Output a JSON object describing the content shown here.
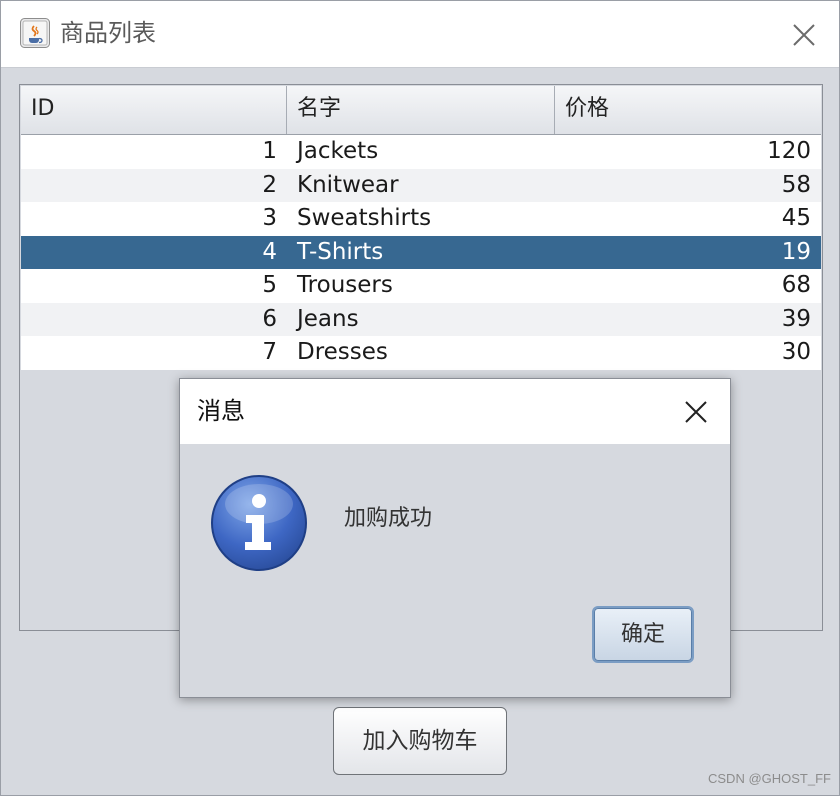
{
  "window": {
    "title": "商品列表",
    "icon": "java-cup-icon"
  },
  "table": {
    "columns": [
      "ID",
      "名字",
      "价格"
    ],
    "rows": [
      {
        "id": "1",
        "name": "Jackets",
        "price": "120"
      },
      {
        "id": "2",
        "name": "Knitwear",
        "price": "58"
      },
      {
        "id": "3",
        "name": "Sweatshirts",
        "price": "45"
      },
      {
        "id": "4",
        "name": "T-Shirts",
        "price": "19"
      },
      {
        "id": "5",
        "name": "Trousers",
        "price": "68"
      },
      {
        "id": "6",
        "name": "Jeans",
        "price": "39"
      },
      {
        "id": "7",
        "name": "Dresses",
        "price": "30"
      }
    ],
    "selected_row": "4"
  },
  "add_cart_button": "加入购物车",
  "dialog": {
    "title": "消息",
    "message": "加购成功",
    "ok_button": "确定",
    "icon": "info-icon"
  },
  "watermark": "CSDN @GHOST_FF",
  "colors": {
    "selection": "#376891",
    "background": "#d6d9df"
  }
}
